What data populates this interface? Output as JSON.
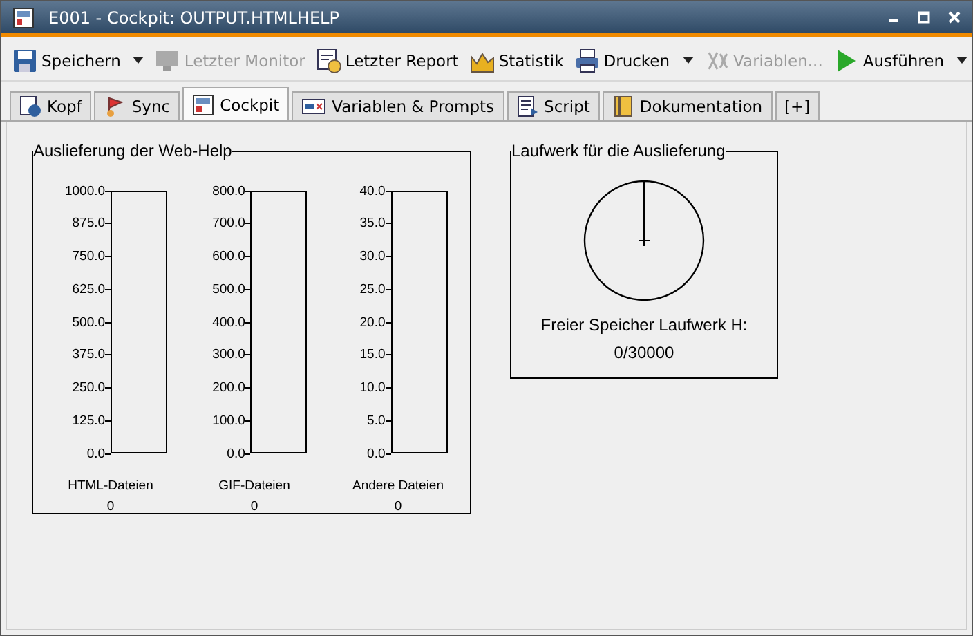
{
  "window": {
    "title": "E001 - Cockpit: OUTPUT.HTMLHELP"
  },
  "toolbar": [
    {
      "label": "Speichern",
      "dropdown": true,
      "disabled": false
    },
    {
      "label": "Letzter Monitor",
      "dropdown": false,
      "disabled": true
    },
    {
      "label": "Letzter Report",
      "dropdown": false,
      "disabled": false
    },
    {
      "label": "Statistik",
      "dropdown": false,
      "disabled": false
    },
    {
      "label": "Drucken",
      "dropdown": true,
      "disabled": false
    },
    {
      "label": "Variablen...",
      "dropdown": false,
      "disabled": true
    },
    {
      "label": "Ausführen",
      "dropdown": true,
      "disabled": false
    }
  ],
  "tabs": [
    {
      "label": "Kopf",
      "selected": false
    },
    {
      "label": "Sync",
      "selected": false
    },
    {
      "label": "Cockpit",
      "selected": true
    },
    {
      "label": "Variablen & Prompts",
      "selected": false
    },
    {
      "label": "Script",
      "selected": false
    },
    {
      "label": "Dokumentation",
      "selected": false
    },
    {
      "label": "[+]",
      "selected": false
    }
  ],
  "delivery": {
    "title": "Auslieferung der Web-Help",
    "gauges": [
      {
        "label": "HTML-Dateien",
        "value": "0",
        "level": 0,
        "ticks": [
          "1000.0",
          "875.0",
          "750.0",
          "625.0",
          "500.0",
          "375.0",
          "250.0",
          "125.0",
          "0.0"
        ]
      },
      {
        "label": "GIF-Dateien",
        "value": "0",
        "level": 0,
        "ticks": [
          "800.0",
          "700.0",
          "600.0",
          "500.0",
          "400.0",
          "300.0",
          "200.0",
          "100.0",
          "0.0"
        ]
      },
      {
        "label": "Andere Dateien",
        "value": "0",
        "level": 0,
        "ticks": [
          "40.0",
          "35.0",
          "30.0",
          "25.0",
          "20.0",
          "15.0",
          "10.0",
          "5.0",
          "0.0"
        ]
      }
    ]
  },
  "drive": {
    "title": "Laufwerk für die Auslieferung",
    "caption": "Freier Speicher Laufwerk H:",
    "value": "0/30000"
  }
}
